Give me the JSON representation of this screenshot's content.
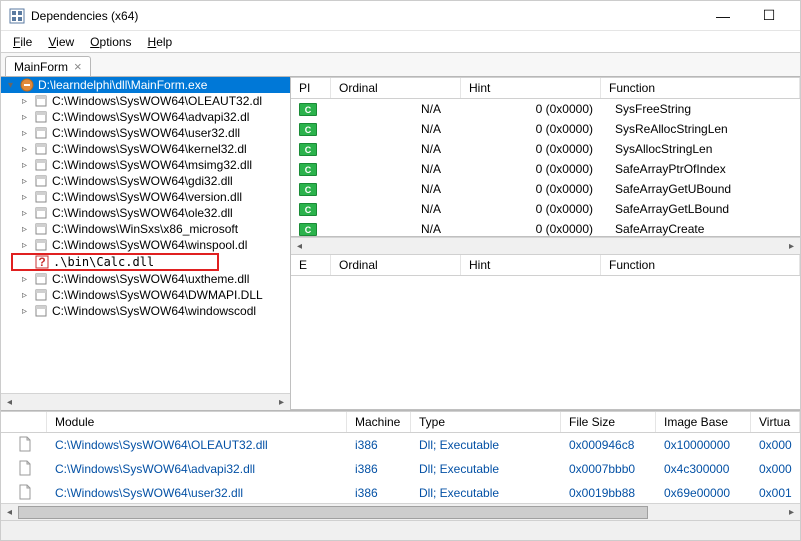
{
  "window": {
    "title": "Dependencies (x64)"
  },
  "menu": {
    "file": "File",
    "view": "View",
    "options": "Options",
    "help": "Help"
  },
  "tab": {
    "label": "MainForm"
  },
  "tree": {
    "root": "D:\\learndelphi\\dll\\MainForm.exe",
    "items": [
      "C:\\Windows\\SysWOW64\\OLEAUT32.dl",
      "C:\\Windows\\SysWOW64\\advapi32.dl",
      "C:\\Windows\\SysWOW64\\user32.dll",
      "C:\\Windows\\SysWOW64\\kernel32.dl",
      "C:\\Windows\\SysWOW64\\msimg32.dll",
      "C:\\Windows\\SysWOW64\\gdi32.dll",
      "C:\\Windows\\SysWOW64\\version.dll",
      "C:\\Windows\\SysWOW64\\ole32.dll",
      "C:\\Windows\\WinSxs\\x86_microsoft",
      "C:\\Windows\\SysWOW64\\winspool.dl"
    ],
    "missing": ".\\bin\\Calc.dll",
    "items2": [
      "C:\\Windows\\SysWOW64\\uxtheme.dll",
      "C:\\Windows\\SysWOW64\\DWMAPI.DLL",
      "C:\\Windows\\SysWOW64\\windowscodl"
    ]
  },
  "imports": {
    "headers": {
      "pi": "PI",
      "ordinal": "Ordinal",
      "hint": "Hint",
      "function": "Function"
    },
    "rows": [
      {
        "ord": "N/A",
        "hint": "0 (0x0000)",
        "fn": "SysFreeString"
      },
      {
        "ord": "N/A",
        "hint": "0 (0x0000)",
        "fn": "SysReAllocStringLen"
      },
      {
        "ord": "N/A",
        "hint": "0 (0x0000)",
        "fn": "SysAllocStringLen"
      },
      {
        "ord": "N/A",
        "hint": "0 (0x0000)",
        "fn": "SafeArrayPtrOfIndex"
      },
      {
        "ord": "N/A",
        "hint": "0 (0x0000)",
        "fn": "SafeArrayGetUBound"
      },
      {
        "ord": "N/A",
        "hint": "0 (0x0000)",
        "fn": "SafeArrayGetLBound"
      },
      {
        "ord": "N/A",
        "hint": "0 (0x0000)",
        "fn": "SafeArrayCreate"
      }
    ]
  },
  "exports": {
    "headers": {
      "e": "E",
      "ordinal": "Ordinal",
      "hint": "Hint",
      "function": "Function"
    }
  },
  "modules": {
    "headers": {
      "module": "Module",
      "machine": "Machine",
      "type": "Type",
      "filesize": "File Size",
      "imagebase": "Image Base",
      "virtual": "Virtua"
    },
    "rows": [
      {
        "module": "C:\\Windows\\SysWOW64\\OLEAUT32.dll",
        "machine": "i386",
        "type": "Dll; Executable",
        "filesize": "0x000946c8",
        "imagebase": "0x10000000",
        "virtual": "0x000"
      },
      {
        "module": "C:\\Windows\\SysWOW64\\advapi32.dll",
        "machine": "i386",
        "type": "Dll; Executable",
        "filesize": "0x0007bbb0",
        "imagebase": "0x4c300000",
        "virtual": "0x000"
      },
      {
        "module": "C:\\Windows\\SysWOW64\\user32.dll",
        "machine": "i386",
        "type": "Dll; Executable",
        "filesize": "0x0019bb88",
        "imagebase": "0x69e00000",
        "virtual": "0x001"
      }
    ]
  }
}
